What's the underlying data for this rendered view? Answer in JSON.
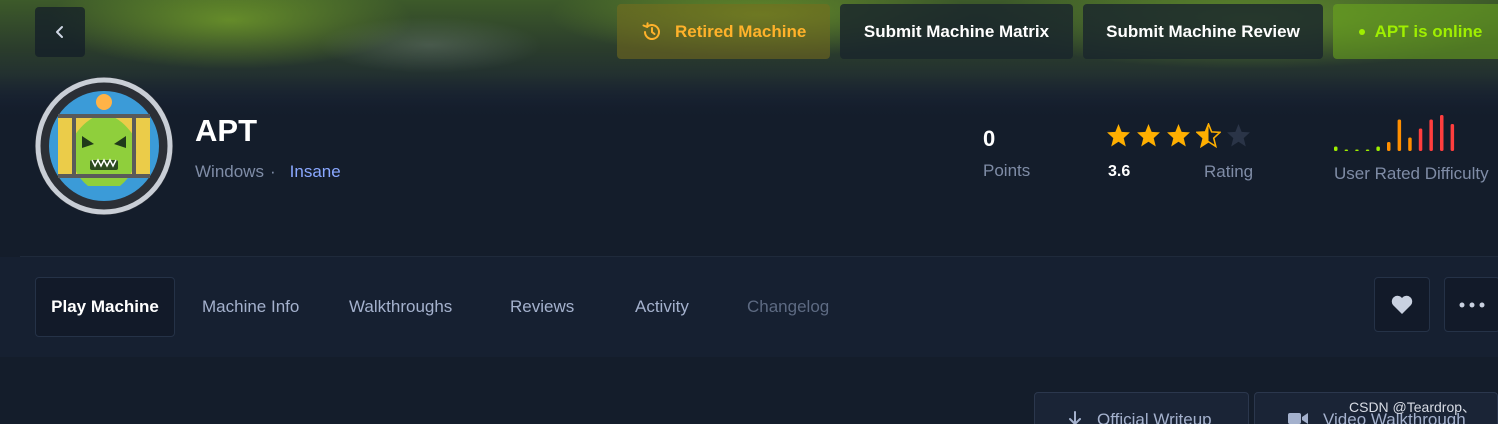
{
  "header": {
    "back_icon": "chevron-left-icon",
    "actions": {
      "retired_label": "Retired Machine",
      "retired_icon": "history-icon",
      "matrix_label": "Submit Machine Matrix",
      "review_label": "Submit Machine Review",
      "online_label": "APT is online"
    }
  },
  "machine": {
    "name": "APT",
    "os": "Windows",
    "separator": "·",
    "difficulty": "Insane",
    "avatar_icon": "green-monster-avatar-icon"
  },
  "stats": {
    "points_value": "0",
    "points_label": "Points",
    "rating_value": "3.6",
    "rating_label": "Rating",
    "stars_filled": 3.5,
    "stars_total": 5,
    "difficulty_label": "User Rated Difficulty",
    "difficulty_bars": [
      1,
      0,
      0,
      0,
      1,
      2,
      7,
      3,
      5,
      7,
      8,
      6
    ]
  },
  "tabs": [
    {
      "label": "Play Machine",
      "active": true
    },
    {
      "label": "Machine Info"
    },
    {
      "label": "Walkthroughs"
    },
    {
      "label": "Reviews"
    },
    {
      "label": "Activity"
    },
    {
      "label": "Changelog",
      "muted": true
    }
  ],
  "icon_buttons": {
    "favorite_icon": "heart-icon",
    "more_icon": "more-dots-icon"
  },
  "resources": {
    "writeup_label": "Official Writeup",
    "writeup_icon": "download-icon",
    "video_label": "Video Walkthrough",
    "video_icon": "video-camera-icon"
  },
  "watermark": "CSDN @Teardrop、",
  "colors": {
    "background": "#141d2b",
    "accent_green": "#9fef00",
    "accent_orange": "#ffb22a",
    "accent_blue": "#8aa8ff",
    "star": "#ffaf00",
    "bar_green": "#9fef00",
    "bar_orange": "#ff8f00",
    "bar_red": "#ff3e3e"
  }
}
